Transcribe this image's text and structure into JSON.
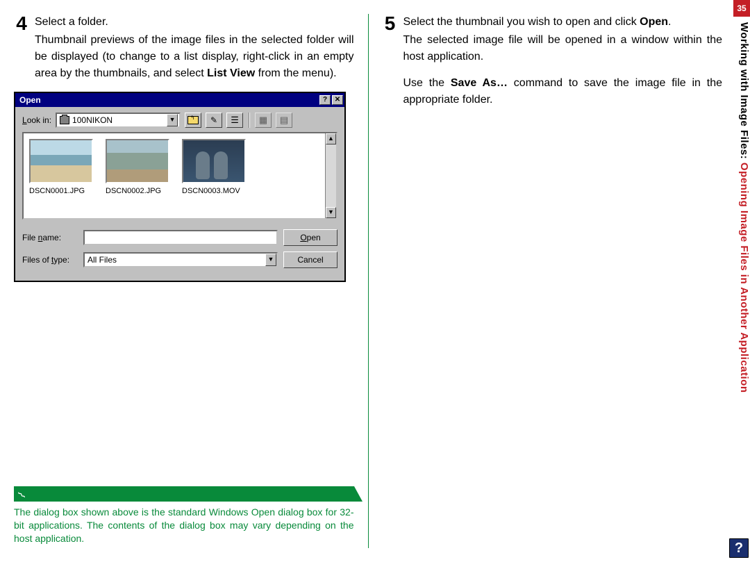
{
  "page_number": "35",
  "side_title_part1": "Working with Image Files:",
  "side_title_part2": " Opening Image Files in Another Application",
  "step4": {
    "num": "4",
    "first_line": "Select a folder.",
    "body": "Thumbnail previews of the image files in the selected folder will be displayed (to change to a list display, right-click in an empty area by the thumbnails, and select ",
    "bold": "List View",
    "after": " from the menu)."
  },
  "step5": {
    "num": "5",
    "line1_a": "Select the thumbnail you wish to open and click ",
    "line1_bold": "Open",
    "line1_b": ".",
    "line2": "The selected image file will be opened in a window within the host application.",
    "para2_a": "Use the ",
    "para2_bold": "Save As…",
    "para2_b": " command to save the image file in the appropriate folder."
  },
  "dialog": {
    "title": "Open",
    "help_btn": "?",
    "close_btn": "✕",
    "look_in_label": "Look in:",
    "look_in_value": "100NIKON",
    "up_icon": "📁",
    "new_icon": "✎",
    "view_icon": "☷",
    "thumb_icon1": "▦",
    "thumb_icon2": "▤",
    "thumbs": [
      {
        "label": "DSCN0001.JPG"
      },
      {
        "label": "DSCN0002.JPG"
      },
      {
        "label": "DSCN0003.MOV"
      }
    ],
    "file_name_label": "File name:",
    "file_name_value": "",
    "files_of_type_label": "Files of type:",
    "files_of_type_value": "All Files",
    "open_btn": "Open",
    "cancel_btn": "Cancel"
  },
  "note": {
    "text": "The dialog box shown above is the standard Windows Open dialog box for 32-bit applications. The contents of the dialog box may vary depending on the host application."
  },
  "help_glyph": "?"
}
